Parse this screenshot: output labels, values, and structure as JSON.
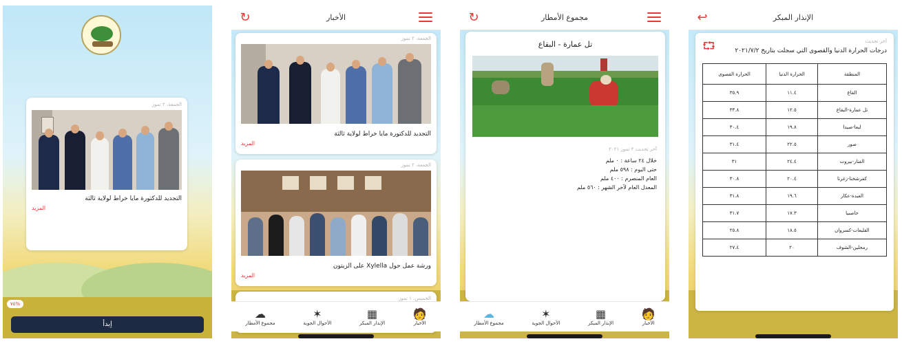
{
  "colors": {
    "accent": "#e53935",
    "dark_button": "#1d2a44"
  },
  "screen1": {
    "card_date": "الجمعة، ٢ تموز",
    "news_title": "التجديد للدكتورة مايا خراط لولاية ثالثة",
    "more": "المزيد",
    "progress_text": "٧٥%",
    "progress_value": 0.75,
    "start_button": "إبدأ"
  },
  "screen2": {
    "title": "الأخبار",
    "news": [
      {
        "date": "الجمعة، ٢ تموز",
        "title": "التجديد للدكتورة مايا خراط لولاية ثالثة",
        "more": "المزيد"
      },
      {
        "date": "الجمعة، ٢ تموز",
        "title": "ورشة عمل حول Xylella على الزيتون",
        "more": "المزيد"
      },
      {
        "date": "الخميس، ١ تموز"
      }
    ],
    "nav": [
      {
        "label": "الأخبار",
        "icon": "farmer-icon"
      },
      {
        "label": "الإنذار المبكر",
        "icon": "field-icon"
      },
      {
        "label": "الأحوال الجوية",
        "icon": "windmill-icon"
      },
      {
        "label": "مجموع الأمطار",
        "icon": "cloud-rain-icon"
      }
    ]
  },
  "screen3": {
    "title": "مجموع الأمطار",
    "card_title": "تل عمارة - البقاع",
    "updated": "آخر تحديث ٢ تموز ٢٠٢١",
    "lines": [
      "خلال ٢٤ ساعة : ٠ ملم",
      "حتى اليوم : ٥٩٨ ملم",
      "العام المنصرم : ٤٠٠ ملم",
      "المعدل العام لآخر الشهر : ٥٦٠ ملم"
    ],
    "nav": [
      {
        "label": "الأخبار",
        "icon": "farmer-icon"
      },
      {
        "label": "الإنذار المبكر",
        "icon": "field-icon"
      },
      {
        "label": "الأحوال الجوية",
        "icon": "windmill-icon"
      },
      {
        "label": "مجموع الأمطار",
        "icon": "cloud-rain-icon"
      }
    ]
  },
  "screen4": {
    "title": "الإنذار المبكر",
    "updated": "آخر تحديث",
    "heading": "درجات الحرارة الدنيا والقصوى التي سجلت بتاريخ ٢٠٢١/٧/٢",
    "headers": [
      "المنطقة",
      "الحرارة الدنيا",
      "الحرارة القصوى"
    ],
    "rows": [
      [
        "القاع",
        "١١.٤",
        "٣٥.٩"
      ],
      [
        "تل عمارة-البقاع",
        "١٢.٥",
        "٣٣.٨"
      ],
      [
        "لبعا-صيدا",
        "١٩.٨",
        "٣٠.٤"
      ],
      [
        "صور",
        "٢٢.٥",
        "٣١.٤"
      ],
      [
        "الفنار-بيروت",
        "٢٤.٤",
        "٣١"
      ],
      [
        "كفرشخنا-زغرتا",
        "٢٠.٤",
        "٣٠.٨"
      ],
      [
        "العبدة-عكار",
        "١٩.٦",
        "٣١.٨"
      ],
      [
        "حاصبيا",
        "١٧.٣",
        "٣١.٧"
      ],
      [
        "القليعات-كسروان",
        "١٨.٥",
        "٢٥.٨"
      ],
      [
        "رمحلين-الشوف",
        "٢٠",
        "٢٧.٤"
      ]
    ]
  }
}
